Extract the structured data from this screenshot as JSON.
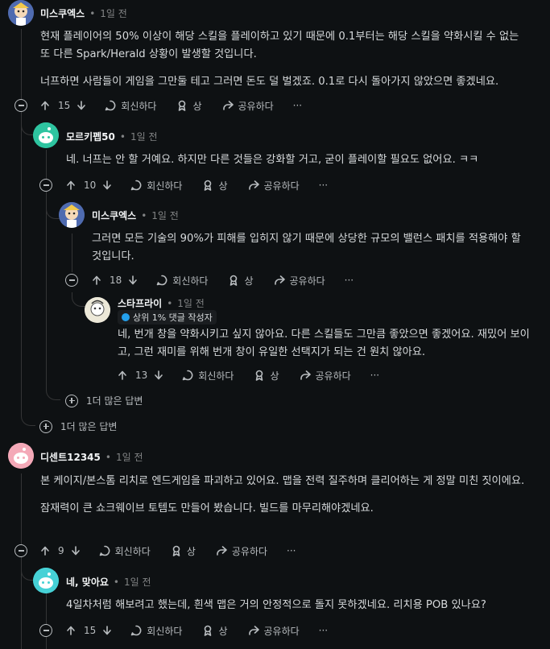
{
  "comments": [
    {
      "author": "미스쿠엑스",
      "time": "1일 전",
      "paragraphs": [
        "현재 플레이어의 50% 이상이 해당 스킬을 플레이하고 있기 때문에 0.1부터는 해당 스킬을 약화시킬 수 없는 또 다른 Spark/Herald 상황이 발생할 것입니다.",
        "너프하면 사람들이 게임을 그만둘 테고 그러면 돈도 덜 벌겠죠. 0.1로 다시 돌아가지 않았으면 좋겠네요."
      ],
      "votes": "15"
    },
    {
      "author": "모르키펩50",
      "time": "1일 전",
      "paragraphs": [
        "네. 너프는 안 할 거예요. 하지만 다른 것들은 강화할 거고, 굳이 플레이할 필요도 없어요. ㅋㅋ"
      ],
      "votes": "10"
    },
    {
      "author": "미스쿠엑스",
      "time": "1일 전",
      "paragraphs": [
        "그러면 모든 기술의 90%가 피해를 입히지 않기 때문에 상당한 규모의 밸런스 패치를 적용해야 할 것입니다."
      ],
      "votes": "18"
    },
    {
      "author": "스타프라이",
      "time": "1일 전",
      "badge": "상위 1% 댓글 작성자",
      "paragraphs": [
        "네, 번개 창을 약화시키고 싶지 않아요. 다른 스킬들도 그만큼 좋았으면 좋겠어요. 재밌어 보이고, 그런 재미를 위해 번개 창이 유일한 선택지가 되는 건 원치 않아요."
      ],
      "votes": "13"
    },
    {
      "author": "디센트12345",
      "time": "1일 전",
      "paragraphs": [
        "본 케이지/본스톰 리치로 엔드게임을 파괴하고 있어요. 맵을 전력 질주하며 클리어하는 게 정말 미친 짓이에요.",
        "잠재력이 큰 쇼크웨이브 토템도 만들어 봤습니다. 빌드를 마무리해야겠네요."
      ],
      "votes": "9"
    },
    {
      "author": "네, 맞아요",
      "time": "1일 전",
      "paragraphs": [
        "4일차처럼 해보려고 했는데, 흰색 맵은 거의 안정적으로 돌지 못하겠네요. 리치용 POB 있나요?"
      ],
      "votes": "15"
    }
  ],
  "actions": {
    "reply": "회신하다",
    "award": "상",
    "share": "공유하다",
    "more": "···"
  },
  "more_replies": [
    "1더 많은 답변",
    "1더 많은 답변"
  ],
  "colors": {
    "background": "#0e1113",
    "text": "#d7dadc",
    "muted": "#818384",
    "line": "#343536"
  }
}
